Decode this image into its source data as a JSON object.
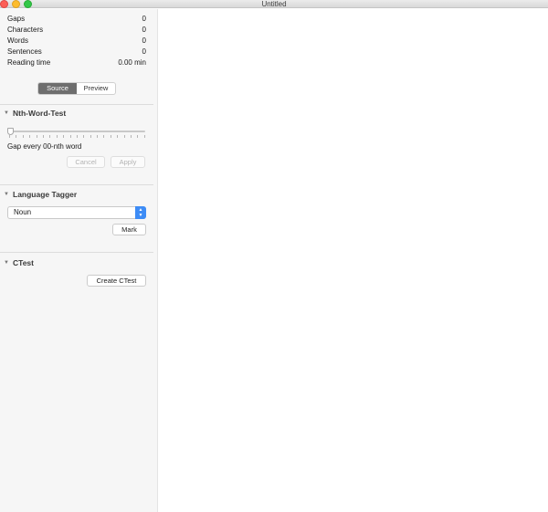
{
  "window": {
    "title": "Untitled"
  },
  "stats": [
    {
      "label": "Gaps",
      "value": "0"
    },
    {
      "label": "Characters",
      "value": "0"
    },
    {
      "label": "Words",
      "value": "0"
    },
    {
      "label": "Sentences",
      "value": "0"
    },
    {
      "label": "Reading time",
      "value": "0.00 min"
    }
  ],
  "view_toggle": {
    "source": "Source",
    "preview": "Preview",
    "selected": "Source"
  },
  "nth_word_test": {
    "header": "Nth-Word-Test",
    "gap_label": "Gap every 00-nth word",
    "slider_value": 0,
    "cancel_label": "Cancel",
    "apply_label": "Apply"
  },
  "language_tagger": {
    "header": "Language Tagger",
    "selected_option": "Noun",
    "mark_label": "Mark"
  },
  "ctest": {
    "header": "CTest",
    "create_label": "Create CTest"
  },
  "colors": {
    "accent": "#3d8cf6",
    "segment_active": "#6e6e6e",
    "sidebar_bg": "#f6f6f6"
  }
}
